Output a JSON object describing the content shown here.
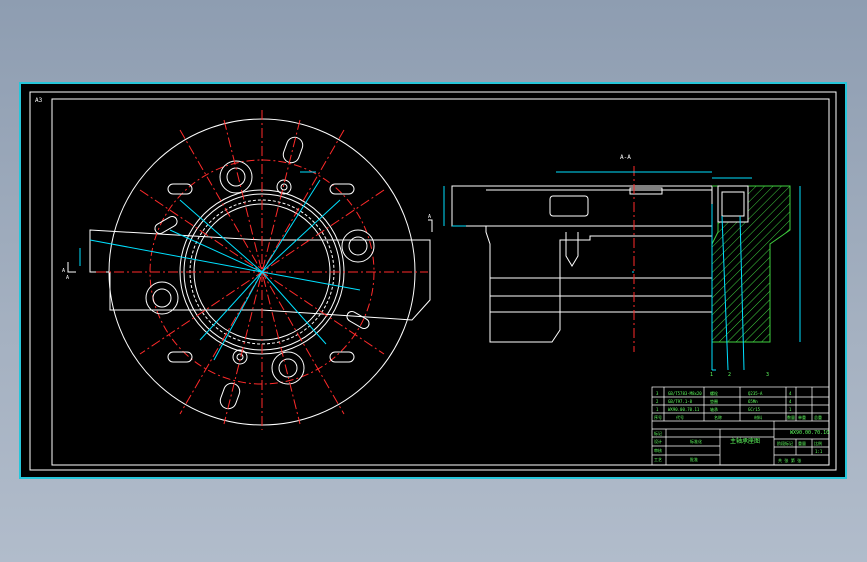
{
  "sheet": {
    "size_label": "A3",
    "section_label": "A-A",
    "part_title": "主轴承座图",
    "drawing_number": "WX90.00.70.10"
  },
  "callouts": {
    "section_marker_left_top": "A",
    "section_marker_left_bottom": "A",
    "section_marker_right": "A",
    "leader_a": "1",
    "leader_b": "2",
    "leader_c": "3"
  },
  "title_block": {
    "bom_rows": [
      [
        "3",
        "GB/T5783-M8x20",
        "螺栓",
        "Q235-A",
        "4",
        "",
        ""
      ],
      [
        "2",
        "GB/T97.1-8",
        "垫圈",
        "65Mn",
        "4",
        "",
        ""
      ],
      [
        "1",
        "WX90.00.70.11",
        "轴承",
        "GCr15",
        "1",
        "",
        ""
      ]
    ],
    "bom_header": [
      "序号",
      "代号",
      "名称",
      "材料",
      "数量",
      "单重",
      "总重"
    ],
    "left_rows": [
      [
        "标记",
        "处数",
        "分区",
        "更改文件号",
        "签名",
        "年月日"
      ],
      [
        "设计",
        "",
        "标准化",
        "",
        "",
        ""
      ],
      [
        "审核",
        "",
        "",
        "",
        "",
        ""
      ],
      [
        "工艺",
        "",
        "批准",
        "",
        "",
        ""
      ]
    ],
    "right_labels": [
      "阶段标记",
      "重量",
      "比例"
    ],
    "scale": "1:1",
    "sheet_info": "共 张 第 张"
  },
  "colors": {
    "frame_bg": "#000000",
    "outline": "#ffffff",
    "center_line": "#ff2a2a",
    "dimension": "#00e0ff",
    "hatch": "#3fcf3f",
    "text_green": "#5fff5f",
    "viewport_border": "#26c6da"
  }
}
